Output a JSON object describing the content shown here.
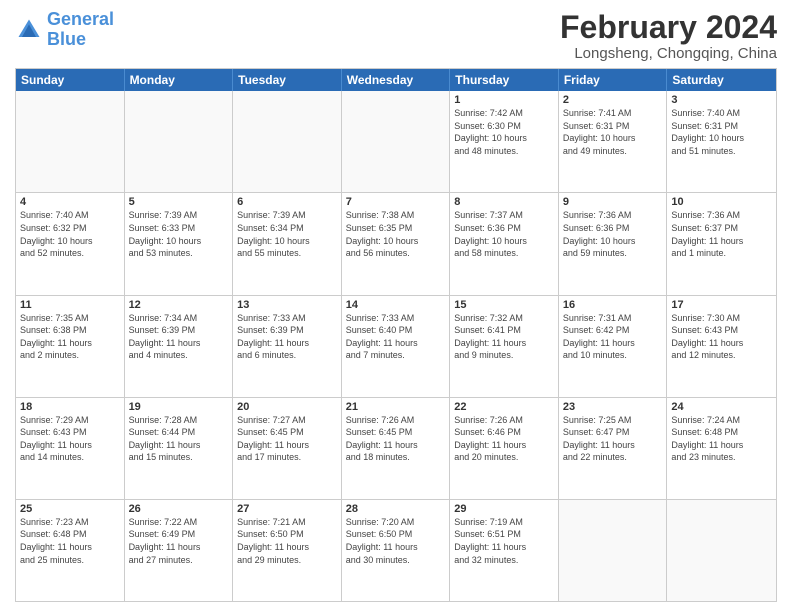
{
  "header": {
    "logo_line1": "General",
    "logo_line2": "Blue",
    "main_title": "February 2024",
    "subtitle": "Longsheng, Chongqing, China"
  },
  "weekdays": [
    "Sunday",
    "Monday",
    "Tuesday",
    "Wednesday",
    "Thursday",
    "Friday",
    "Saturday"
  ],
  "weeks": [
    [
      {
        "day": "",
        "info": ""
      },
      {
        "day": "",
        "info": ""
      },
      {
        "day": "",
        "info": ""
      },
      {
        "day": "",
        "info": ""
      },
      {
        "day": "1",
        "info": "Sunrise: 7:42 AM\nSunset: 6:30 PM\nDaylight: 10 hours\nand 48 minutes."
      },
      {
        "day": "2",
        "info": "Sunrise: 7:41 AM\nSunset: 6:31 PM\nDaylight: 10 hours\nand 49 minutes."
      },
      {
        "day": "3",
        "info": "Sunrise: 7:40 AM\nSunset: 6:31 PM\nDaylight: 10 hours\nand 51 minutes."
      }
    ],
    [
      {
        "day": "4",
        "info": "Sunrise: 7:40 AM\nSunset: 6:32 PM\nDaylight: 10 hours\nand 52 minutes."
      },
      {
        "day": "5",
        "info": "Sunrise: 7:39 AM\nSunset: 6:33 PM\nDaylight: 10 hours\nand 53 minutes."
      },
      {
        "day": "6",
        "info": "Sunrise: 7:39 AM\nSunset: 6:34 PM\nDaylight: 10 hours\nand 55 minutes."
      },
      {
        "day": "7",
        "info": "Sunrise: 7:38 AM\nSunset: 6:35 PM\nDaylight: 10 hours\nand 56 minutes."
      },
      {
        "day": "8",
        "info": "Sunrise: 7:37 AM\nSunset: 6:36 PM\nDaylight: 10 hours\nand 58 minutes."
      },
      {
        "day": "9",
        "info": "Sunrise: 7:36 AM\nSunset: 6:36 PM\nDaylight: 10 hours\nand 59 minutes."
      },
      {
        "day": "10",
        "info": "Sunrise: 7:36 AM\nSunset: 6:37 PM\nDaylight: 11 hours\nand 1 minute."
      }
    ],
    [
      {
        "day": "11",
        "info": "Sunrise: 7:35 AM\nSunset: 6:38 PM\nDaylight: 11 hours\nand 2 minutes."
      },
      {
        "day": "12",
        "info": "Sunrise: 7:34 AM\nSunset: 6:39 PM\nDaylight: 11 hours\nand 4 minutes."
      },
      {
        "day": "13",
        "info": "Sunrise: 7:33 AM\nSunset: 6:39 PM\nDaylight: 11 hours\nand 6 minutes."
      },
      {
        "day": "14",
        "info": "Sunrise: 7:33 AM\nSunset: 6:40 PM\nDaylight: 11 hours\nand 7 minutes."
      },
      {
        "day": "15",
        "info": "Sunrise: 7:32 AM\nSunset: 6:41 PM\nDaylight: 11 hours\nand 9 minutes."
      },
      {
        "day": "16",
        "info": "Sunrise: 7:31 AM\nSunset: 6:42 PM\nDaylight: 11 hours\nand 10 minutes."
      },
      {
        "day": "17",
        "info": "Sunrise: 7:30 AM\nSunset: 6:43 PM\nDaylight: 11 hours\nand 12 minutes."
      }
    ],
    [
      {
        "day": "18",
        "info": "Sunrise: 7:29 AM\nSunset: 6:43 PM\nDaylight: 11 hours\nand 14 minutes."
      },
      {
        "day": "19",
        "info": "Sunrise: 7:28 AM\nSunset: 6:44 PM\nDaylight: 11 hours\nand 15 minutes."
      },
      {
        "day": "20",
        "info": "Sunrise: 7:27 AM\nSunset: 6:45 PM\nDaylight: 11 hours\nand 17 minutes."
      },
      {
        "day": "21",
        "info": "Sunrise: 7:26 AM\nSunset: 6:45 PM\nDaylight: 11 hours\nand 18 minutes."
      },
      {
        "day": "22",
        "info": "Sunrise: 7:26 AM\nSunset: 6:46 PM\nDaylight: 11 hours\nand 20 minutes."
      },
      {
        "day": "23",
        "info": "Sunrise: 7:25 AM\nSunset: 6:47 PM\nDaylight: 11 hours\nand 22 minutes."
      },
      {
        "day": "24",
        "info": "Sunrise: 7:24 AM\nSunset: 6:48 PM\nDaylight: 11 hours\nand 23 minutes."
      }
    ],
    [
      {
        "day": "25",
        "info": "Sunrise: 7:23 AM\nSunset: 6:48 PM\nDaylight: 11 hours\nand 25 minutes."
      },
      {
        "day": "26",
        "info": "Sunrise: 7:22 AM\nSunset: 6:49 PM\nDaylight: 11 hours\nand 27 minutes."
      },
      {
        "day": "27",
        "info": "Sunrise: 7:21 AM\nSunset: 6:50 PM\nDaylight: 11 hours\nand 29 minutes."
      },
      {
        "day": "28",
        "info": "Sunrise: 7:20 AM\nSunset: 6:50 PM\nDaylight: 11 hours\nand 30 minutes."
      },
      {
        "day": "29",
        "info": "Sunrise: 7:19 AM\nSunset: 6:51 PM\nDaylight: 11 hours\nand 32 minutes."
      },
      {
        "day": "",
        "info": ""
      },
      {
        "day": "",
        "info": ""
      }
    ]
  ]
}
